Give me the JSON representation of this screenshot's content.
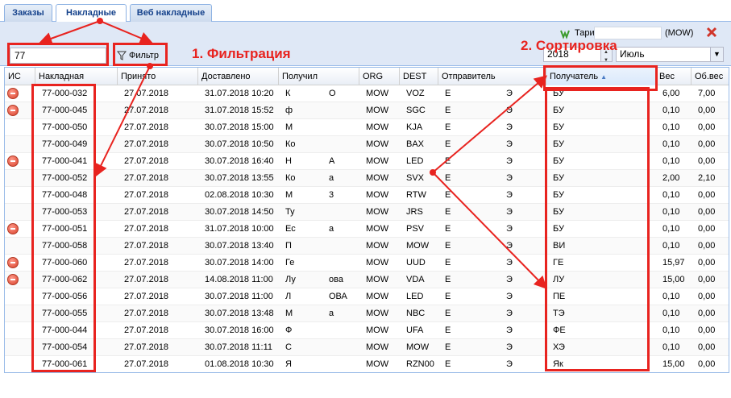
{
  "tabs": [
    {
      "label": "Заказы"
    },
    {
      "label": "Накладные"
    },
    {
      "label": "Веб накладные"
    }
  ],
  "toolbar": {
    "search_value": "77",
    "filter_label": "Фильтр",
    "tariffs_label": "Тарифы",
    "tariffs_value": "",
    "mow_label": "(MOW)",
    "year": "2018",
    "month": "Июль"
  },
  "annotations": {
    "filtering": "1. Фильтрация",
    "sorting": "2. Сортировка"
  },
  "grid": {
    "columns": [
      "ИС",
      "Накладная",
      "Принято",
      "Доставлено",
      "Получил",
      "ORG",
      "DEST",
      "Отправитель",
      "Получатель",
      "Вес",
      "Об.вес"
    ],
    "rows": [
      {
        "ic": true,
        "waybill": "77-000-032",
        "accepted": "27.07.2018",
        "delivered": "31.07.2018 10:20",
        "recv": "К",
        "recv2": "О",
        "org": "MOW",
        "dest": "VOZ",
        "sender": "Е",
        "sender2": "Э",
        "receiver": "БУ",
        "weight": "6,00",
        "vol": "7,00"
      },
      {
        "ic": true,
        "waybill": "77-000-045",
        "accepted": "27.07.2018",
        "delivered": "31.07.2018 15:52",
        "recv": "ф",
        "recv2": "",
        "org": "MOW",
        "dest": "SGC",
        "sender": "Е",
        "sender2": "Э",
        "receiver": "БУ",
        "weight": "0,10",
        "vol": "0,00"
      },
      {
        "ic": false,
        "waybill": "77-000-050",
        "accepted": "27.07.2018",
        "delivered": "30.07.2018 15:00",
        "recv": "М",
        "recv2": "",
        "org": "MOW",
        "dest": "KJA",
        "sender": "Е",
        "sender2": "Э",
        "receiver": "БУ",
        "weight": "0,10",
        "vol": "0,00"
      },
      {
        "ic": false,
        "waybill": "77-000-049",
        "accepted": "27.07.2018",
        "delivered": "30.07.2018 10:50",
        "recv": "Ко",
        "recv2": "",
        "org": "MOW",
        "dest": "BAX",
        "sender": "Е",
        "sender2": "Э",
        "receiver": "БУ",
        "weight": "0,10",
        "vol": "0,00"
      },
      {
        "ic": true,
        "waybill": "77-000-041",
        "accepted": "27.07.2018",
        "delivered": "30.07.2018 16:40",
        "recv": "Н",
        "recv2": "А",
        "org": "MOW",
        "dest": "LED",
        "sender": "Е",
        "sender2": "Э",
        "receiver": "БУ",
        "weight": "0,10",
        "vol": "0,00"
      },
      {
        "ic": false,
        "waybill": "77-000-052",
        "accepted": "27.07.2018",
        "delivered": "30.07.2018 13:55",
        "recv": "Ко",
        "recv2": "а",
        "org": "MOW",
        "dest": "SVX",
        "sender": "Е",
        "sender2": "Э",
        "receiver": "БУ",
        "weight": "2,00",
        "vol": "2,10"
      },
      {
        "ic": false,
        "waybill": "77-000-048",
        "accepted": "27.07.2018",
        "delivered": "02.08.2018 10:30",
        "recv": "М",
        "recv2": "3",
        "org": "MOW",
        "dest": "RTW",
        "sender": "Е",
        "sender2": "Э",
        "receiver": "БУ",
        "weight": "0,10",
        "vol": "0,00"
      },
      {
        "ic": false,
        "waybill": "77-000-053",
        "accepted": "27.07.2018",
        "delivered": "30.07.2018 14:50",
        "recv": "Ту",
        "recv2": "",
        "org": "MOW",
        "dest": "JRS",
        "sender": "Е",
        "sender2": "Э",
        "receiver": "БУ",
        "weight": "0,10",
        "vol": "0,00"
      },
      {
        "ic": true,
        "waybill": "77-000-051",
        "accepted": "27.07.2018",
        "delivered": "31.07.2018 10:00",
        "recv": "Ес",
        "recv2": "а",
        "org": "MOW",
        "dest": "PSV",
        "sender": "Е",
        "sender2": "Э",
        "receiver": "БУ",
        "weight": "0,10",
        "vol": "0,00"
      },
      {
        "ic": false,
        "waybill": "77-000-058",
        "accepted": "27.07.2018",
        "delivered": "30.07.2018 13:40",
        "recv": "П",
        "recv2": "",
        "org": "MOW",
        "dest": "MOW",
        "sender": "Е",
        "sender2": "Э",
        "receiver": "ВИ",
        "weight": "0,10",
        "vol": "0,00"
      },
      {
        "ic": true,
        "waybill": "77-000-060",
        "accepted": "27.07.2018",
        "delivered": "30.07.2018 14:00",
        "recv": "Ге",
        "recv2": "",
        "org": "MOW",
        "dest": "UUD",
        "sender": "Е",
        "sender2": "Э",
        "receiver": "ГЕ",
        "weight": "15,97",
        "vol": "0,00"
      },
      {
        "ic": true,
        "waybill": "77-000-062",
        "accepted": "27.07.2018",
        "delivered": "14.08.2018 11:00",
        "recv": "Лу",
        "recv2": "ова",
        "org": "MOW",
        "dest": "VDA",
        "sender": "Е",
        "sender2": "Э",
        "receiver": "ЛУ",
        "weight": "15,00",
        "vol": "0,00"
      },
      {
        "ic": false,
        "waybill": "77-000-056",
        "accepted": "27.07.2018",
        "delivered": "30.07.2018 11:00",
        "recv": "Л",
        "recv2": "ОВА",
        "org": "MOW",
        "dest": "LED",
        "sender": "Е",
        "sender2": "Э",
        "receiver": "ПЕ",
        "weight": "0,10",
        "vol": "0,00"
      },
      {
        "ic": false,
        "waybill": "77-000-055",
        "accepted": "27.07.2018",
        "delivered": "30.07.2018 13:48",
        "recv": "М",
        "recv2": "а",
        "org": "MOW",
        "dest": "NBC",
        "sender": "Е",
        "sender2": "Э",
        "receiver": "ТЭ",
        "weight": "0,10",
        "vol": "0,00"
      },
      {
        "ic": false,
        "waybill": "77-000-044",
        "accepted": "27.07.2018",
        "delivered": "30.07.2018 16:00",
        "recv": "Ф",
        "recv2": "",
        "org": "MOW",
        "dest": "UFA",
        "sender": "Е",
        "sender2": "Э",
        "receiver": "ФЕ",
        "weight": "0,10",
        "vol": "0,00"
      },
      {
        "ic": false,
        "waybill": "77-000-054",
        "accepted": "27.07.2018",
        "delivered": "30.07.2018 11:11",
        "recv": "С",
        "recv2": "",
        "org": "MOW",
        "dest": "MOW",
        "sender": "Е",
        "sender2": "Э",
        "receiver": "ХЭ",
        "weight": "0,10",
        "vol": "0,00"
      },
      {
        "ic": false,
        "waybill": "77-000-061",
        "accepted": "27.07.2018",
        "delivered": "01.08.2018 10:30",
        "recv": "Я",
        "recv2": "",
        "org": "MOW",
        "dest": "RZN00",
        "sender": "Е",
        "sender2": "Э",
        "receiver": "Як",
        "weight": "15,00",
        "vol": "0,00"
      }
    ]
  },
  "colors": {
    "annotation": "#e8231f",
    "header_bg": "#dfe8f6",
    "tab_text": "#15428b"
  }
}
